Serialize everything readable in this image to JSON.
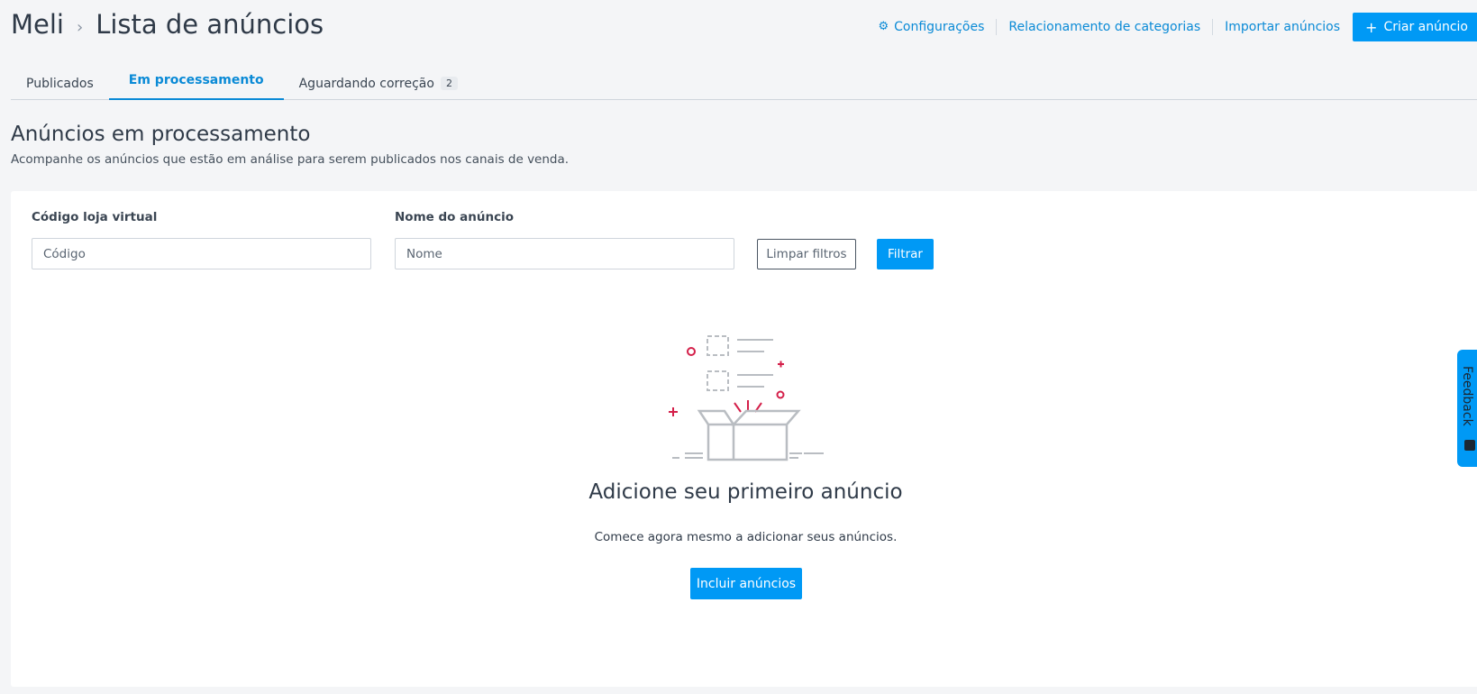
{
  "breadcrumb": {
    "root": "Meli",
    "separator": "›",
    "current": "Lista de anúncios"
  },
  "header_actions": {
    "settings_label": "Configurações",
    "categories_label": "Relacionamento de categorias",
    "import_label": "Importar anúncios",
    "create_label": "Criar anúncio",
    "create_icon": "+"
  },
  "tabs": [
    {
      "label": "Publicados",
      "active": false
    },
    {
      "label": "Em processamento",
      "active": true
    },
    {
      "label": "Aguardando correção",
      "badge": "2",
      "active": false
    }
  ],
  "section": {
    "title": "Anúncios em processamento",
    "subtitle": "Acompanhe os anúncios que estão em análise para serem publicados nos canais de venda."
  },
  "filters": {
    "code_label": "Código loja virtual",
    "code_placeholder": "Código",
    "name_label": "Nome do anúncio",
    "name_placeholder": "Nome",
    "clear_label": "Limpar filtros",
    "filter_label": "Filtrar"
  },
  "empty_state": {
    "title": "Adicione seu primeiro anúncio",
    "text": "Comece agora mesmo a adicionar seus anúncios.",
    "button_label": "Incluir anúncios",
    "illustration_icon": "open-box-icon"
  },
  "feedback": {
    "label": "Feedback"
  },
  "colors": {
    "primary": "#0099f5",
    "link": "#0a8ad6",
    "accent": "#d4204a",
    "background": "#f4f5f7"
  }
}
